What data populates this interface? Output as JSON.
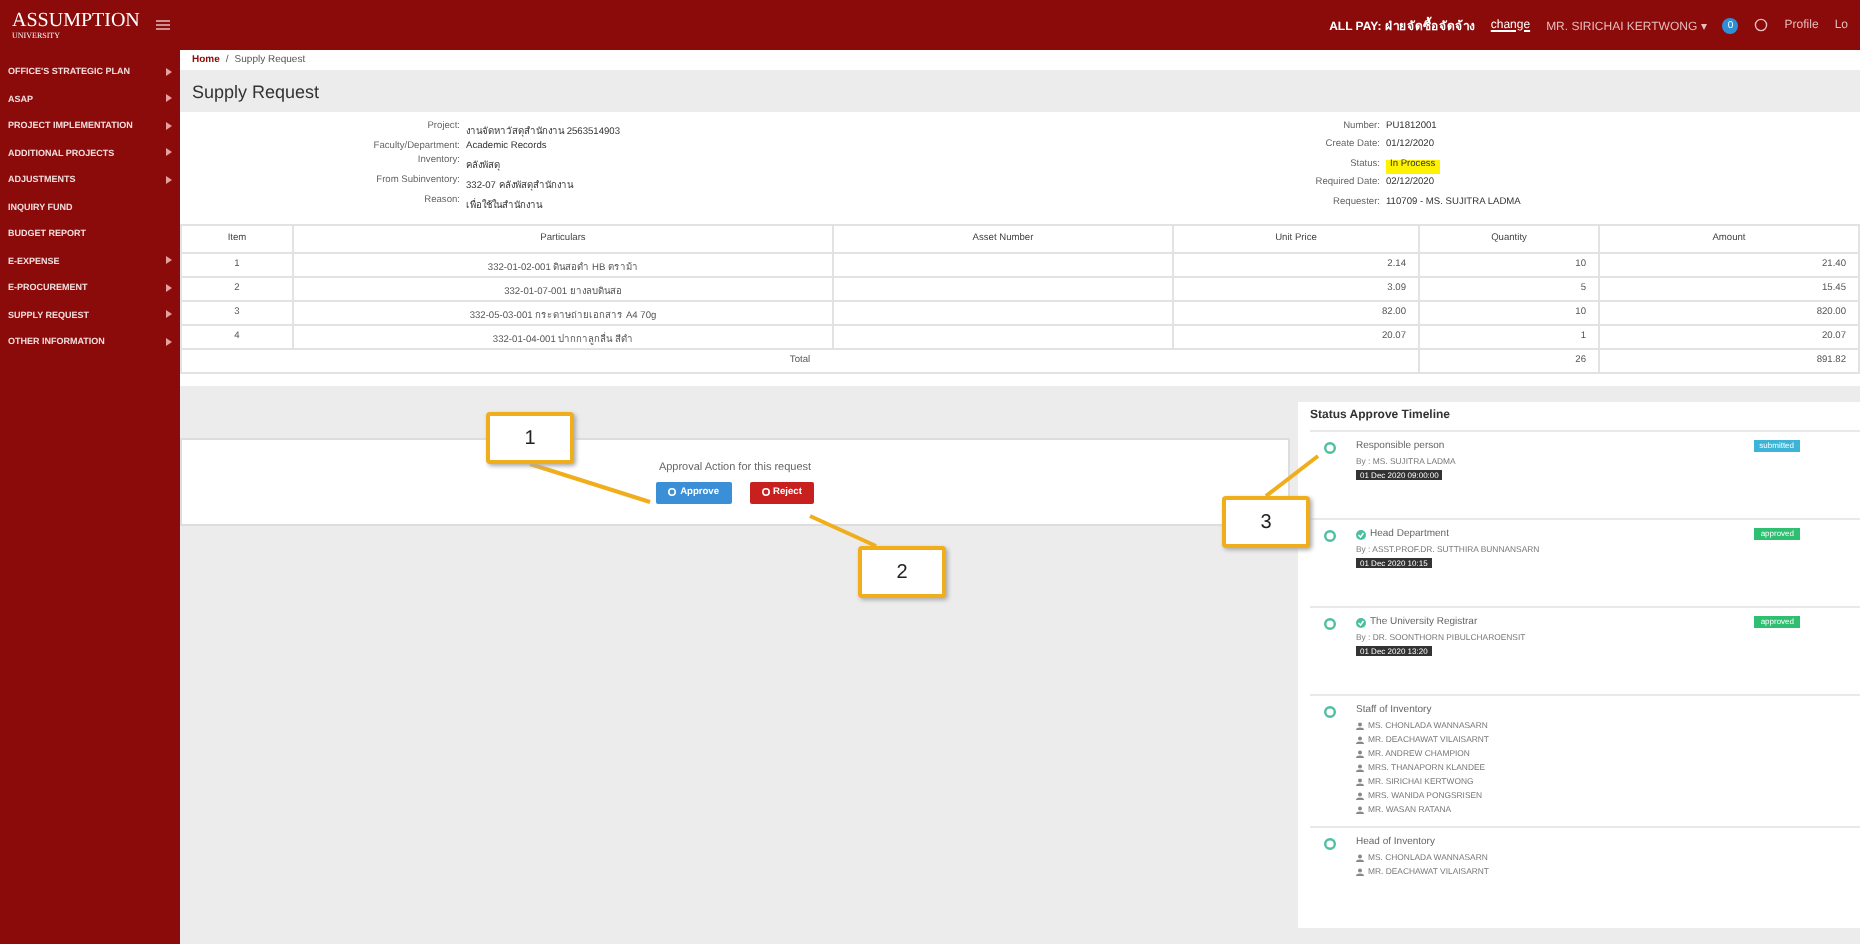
{
  "header": {
    "logo": "ASSUMPTION",
    "logo_sub": "UNIVERSITY",
    "role_label": "ALL PAY: ฝ่ายจัดซื้อจัดจ้าง",
    "change_link": "change",
    "user": "MR. SIRICHAI KERTWONG ▾",
    "notifications": "0",
    "profile": "Profile",
    "logout": "Lo"
  },
  "sidebar": {
    "items": [
      {
        "label": "OFFICE'S STRATEGIC PLAN",
        "has_submenu": true
      },
      {
        "label": "ASAP",
        "has_submenu": true
      },
      {
        "label": "PROJECT IMPLEMENTATION",
        "has_submenu": true
      },
      {
        "label": "ADDITIONAL PROJECTS",
        "has_submenu": true
      },
      {
        "label": "ADJUSTMENTS",
        "has_submenu": true
      },
      {
        "label": "INQUIRY FUND",
        "has_submenu": false
      },
      {
        "label": "BUDGET REPORT",
        "has_submenu": false
      },
      {
        "label": "E-EXPENSE",
        "has_submenu": true
      },
      {
        "label": "E-PROCUREMENT",
        "has_submenu": true
      },
      {
        "label": "SUPPLY REQUEST",
        "has_submenu": true
      },
      {
        "label": "OTHER INFORMATION",
        "has_submenu": true
      }
    ]
  },
  "breadcrumb": [
    "Home",
    "Supply Request"
  ],
  "breadcrumb_separator": "/",
  "page_title": "Supply Request",
  "info_left": [
    {
      "label": "Project:",
      "value": "งานจัดหาวัสดุสำนักงาน 2563514903"
    },
    {
      "label": "Faculty/Department:",
      "value": "Academic Records"
    },
    {
      "label": "Inventory:",
      "value": "คลังพัสดุ"
    },
    {
      "label": "From Subinventory:",
      "value": "332-07 คลังพัสดุสำนักงาน"
    },
    {
      "label": "Reason:",
      "value": "เพื่อใช้ในสำนักงาน"
    }
  ],
  "info_right": [
    {
      "label": "Number:",
      "value": "PU1812001",
      "kind": "text"
    },
    {
      "label": "Create Date:",
      "value": "01/12/2020",
      "kind": "text"
    },
    {
      "label": "Status:",
      "value": "In Process",
      "kind": "badge"
    },
    {
      "label": "Required Date:",
      "value": "02/12/2020",
      "kind": "text"
    },
    {
      "label": "Requester:",
      "value": "110709 - MS. SUJITRA LADMA",
      "kind": "text"
    }
  ],
  "table": {
    "columns": [
      "Item",
      "Particulars",
      "Asset Number",
      "Unit Price",
      "Quantity",
      "Amount"
    ],
    "rows": [
      [
        "1",
        "332-01-02-001 ดินสอดำ HB ตราม้า",
        "",
        "2.14",
        "10",
        "21.40"
      ],
      [
        "2",
        "332-01-07-001 ยางลบดินสอ",
        "",
        "3.09",
        "5",
        "15.45"
      ],
      [
        "3",
        "332-05-03-001 กระดาษถ่ายเอกสาร A4 70g",
        "",
        "82.00",
        "10",
        "820.00"
      ],
      [
        "4",
        "332-01-04-001 ปากกาลูกลื่น สีดำ",
        "",
        "20.07",
        "1",
        "20.07"
      ]
    ],
    "total": {
      "label": "Total",
      "quantity": "26",
      "amount": "891.82"
    }
  },
  "approval": {
    "title": "Approval Action for this request",
    "buttons": [
      {
        "label": "Approve",
        "kind": "approve"
      },
      {
        "label": "Reject",
        "kind": "reject"
      }
    ]
  },
  "timeline": {
    "title": "Status Approve Timeline",
    "entries": [
      {
        "title": "Responsible person",
        "checked": false,
        "by": "By : MS. SUJITRA LADMA",
        "time": "01 Dec 2020 09:00:00",
        "status": "submitted",
        "color": "#3bb4d8"
      },
      {
        "title": "Head Department",
        "checked": true,
        "by": "By : ASST.PROF.DR. SUTTHIRA BUNNANSARN",
        "time": "01 Dec 2020 10:15",
        "status": "approved",
        "color": "#2fbf71"
      },
      {
        "title": "The University Registrar",
        "checked": true,
        "by": "By : DR. SOONTHORN PIBULCHAROENSIT",
        "time": "01 Dec 2020 13:20",
        "status": "approved",
        "color": "#2fbf71"
      },
      {
        "title": "Staff of Inventory",
        "checked": false,
        "people": [
          "MS. CHONLADA WANNASARN",
          "MR. DEACHAWAT VILAISARNT",
          "MR. ANDREW CHAMPION",
          "MRS. THANAPORN KLANDEE",
          "MR. SIRICHAI KERTWONG",
          "MRS. WANIDA PONGSRISEN",
          "MR. WASAN RATANA"
        ]
      },
      {
        "title": "Head of Inventory",
        "checked": false,
        "people": [
          "MS. CHONLADA WANNASARN",
          "MR. DEACHAWAT VILAISARNT"
        ]
      }
    ]
  },
  "annotations": [
    "1",
    "2",
    "3"
  ]
}
